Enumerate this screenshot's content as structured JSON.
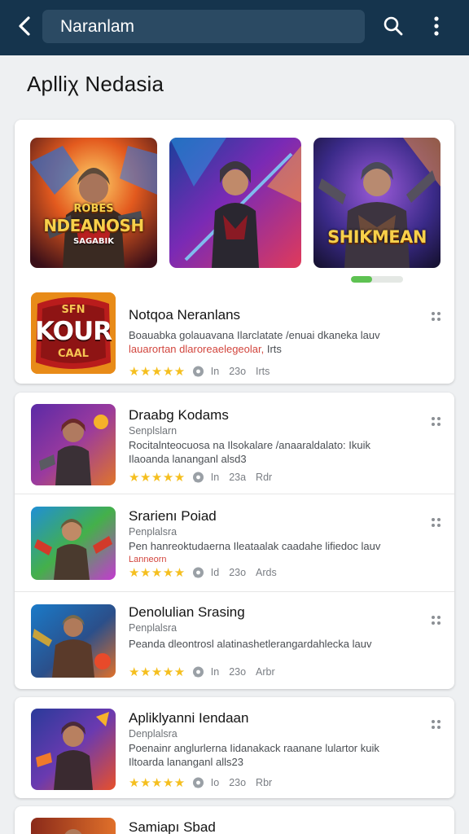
{
  "header": {
    "search_value": "Naranlam",
    "colors": {
      "bar": "#15344d",
      "search_field": "#2b4a63"
    }
  },
  "page": {
    "title": "Aplliχ Nedasia"
  },
  "featured": {
    "banners": [
      {
        "title_line1": "ROBES",
        "title_line2": "NDEANOSH",
        "subtitle": "SAGABIK"
      },
      {
        "title_line1": "",
        "title_line2": "",
        "subtitle": ""
      },
      {
        "title_line1": "",
        "title_line2": "SHIKMEAN",
        "subtitle": ""
      }
    ],
    "carousel_progress": 0.4,
    "app": {
      "icon_text_top": "SFN",
      "icon_text_main": "KOUR",
      "icon_text_bottom": "CAAL",
      "name": "Notqoa Neranlans",
      "desc_line1": "Boauabka golauavana Ilarclatate /enuai dkaneka lauv",
      "desc_line2_warning": "lauarortan dlaroreaelegeolar, ",
      "desc_line2_rest": "Irts",
      "rating_text": "★★★★★",
      "m1": "In",
      "m2": "23o",
      "m3": "Irts"
    }
  },
  "apps": [
    {
      "name": "Draabg Kodams",
      "subtitle": "Senplslarn",
      "desc_line1": "Rocitalnteocuosa na Ilsokalare /anaaraldalato: Ikuik",
      "desc_line2": "Ilaoanda lananganl alsd3",
      "desc_line2_warning": "",
      "rating_text": "★★★★★",
      "m1": "In",
      "m2": "23a",
      "m3": "Rdr"
    },
    {
      "name": "Srarienı Poiad",
      "subtitle": "Penplalsra",
      "desc_line1": "Pen hanreoktudaerna Ileataalak caadahe lifiedoc lauv",
      "desc_line2": "",
      "desc_line2_warning": "Lanneorn",
      "rating_text": "★★★★★",
      "m1": "Id",
      "m2": "23o",
      "m3": "Ards"
    },
    {
      "name": "Denolulian Srasing",
      "subtitle": "Penplalsra",
      "desc_line1": "Peanda dleontrosl alatinashetlerangardahlecka lauv",
      "desc_line2": "",
      "desc_line2_warning": "",
      "rating_text": "★★★★★",
      "m1": "In",
      "m2": "23o",
      "m3": "Arbr"
    },
    {
      "name": "Apliklyanni Iendaan",
      "subtitle": "Denplalsra",
      "desc_line1": "Poenainr anglurlerna Iidanakack raanane lulartor kuik",
      "desc_line2": "Iltoarda lananganl alls23",
      "desc_line2_warning": "",
      "rating_text": "★★★★★",
      "m1": "Io",
      "m2": "23o",
      "m3": "Rbr"
    },
    {
      "name": "Samiapı Sbad",
      "subtitle": "",
      "desc_line1": "",
      "desc_line2": "",
      "desc_line2_warning": "",
      "rating_text": "",
      "m1": "",
      "m2": "",
      "m3": ""
    }
  ]
}
